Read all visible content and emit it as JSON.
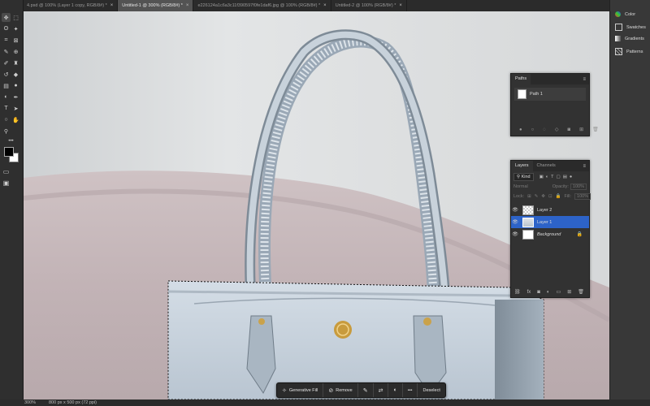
{
  "app": {
    "name": "Photoshop"
  },
  "tabs": [
    {
      "label": "4.psd @ 100% (Layer 1 copy, RGB/8#) *",
      "active": false
    },
    {
      "label": "Untitled-1 @ 300% (RGB/8#) *",
      "active": true
    },
    {
      "label": "e226124a1c6a3c11f390597f0fe1daf6.jpg @ 100% (RGB/8#) *",
      "active": false
    },
    {
      "label": "Untitled-2 @ 100% (RGB/8#) *",
      "active": false
    }
  ],
  "toolbar": {
    "icons": [
      "move-icon",
      "marquee-icon",
      "lasso-icon",
      "magic-wand-icon",
      "crop-icon",
      "frame-icon",
      "eyedropper-icon",
      "healing-icon",
      "brush-icon",
      "stamp-icon",
      "history-brush-icon",
      "eraser-icon",
      "gradient-icon",
      "blur-icon",
      "dodge-icon",
      "pen-icon",
      "type-icon",
      "path-select-icon",
      "shape-icon",
      "hand-icon",
      "zoom-icon",
      "more-tools-icon"
    ],
    "foreground_color": "#000000",
    "background_color": "#ffffff"
  },
  "right_dock": {
    "items": [
      {
        "label": "Color",
        "icon": "color-icon"
      },
      {
        "label": "Swatches",
        "icon": "swatches-icon"
      },
      {
        "label": "Gradients",
        "icon": "gradients-icon"
      },
      {
        "label": "Patterns",
        "icon": "patterns-icon"
      }
    ]
  },
  "paths_panel": {
    "title": "Paths",
    "items": [
      {
        "label": "Path 1"
      }
    ]
  },
  "layers_panel": {
    "tabs": [
      "Layers",
      "Channels"
    ],
    "filter_label": "Kind",
    "blend_mode": "Normal",
    "opacity_label": "Opacity:",
    "opacity_value": "100%",
    "lock_label": "Lock:",
    "fill_label": "Fill:",
    "fill_value": "100%",
    "layers": [
      {
        "name": "Layer 2",
        "selected": false
      },
      {
        "name": "Layer 1",
        "selected": true
      },
      {
        "name": "Background",
        "selected": false,
        "locked": true
      }
    ]
  },
  "context_bar": {
    "generative_fill": "Generative Fill",
    "remove": "Remove",
    "more": "•••",
    "deselect": "Deselect"
  },
  "status": {
    "zoom": "300%",
    "doc_info": "800 px x 500 px (72 ppi)"
  },
  "colors": {
    "accent": "#2d63c8",
    "panel_bg": "#323232",
    "workspace": "#535353"
  }
}
